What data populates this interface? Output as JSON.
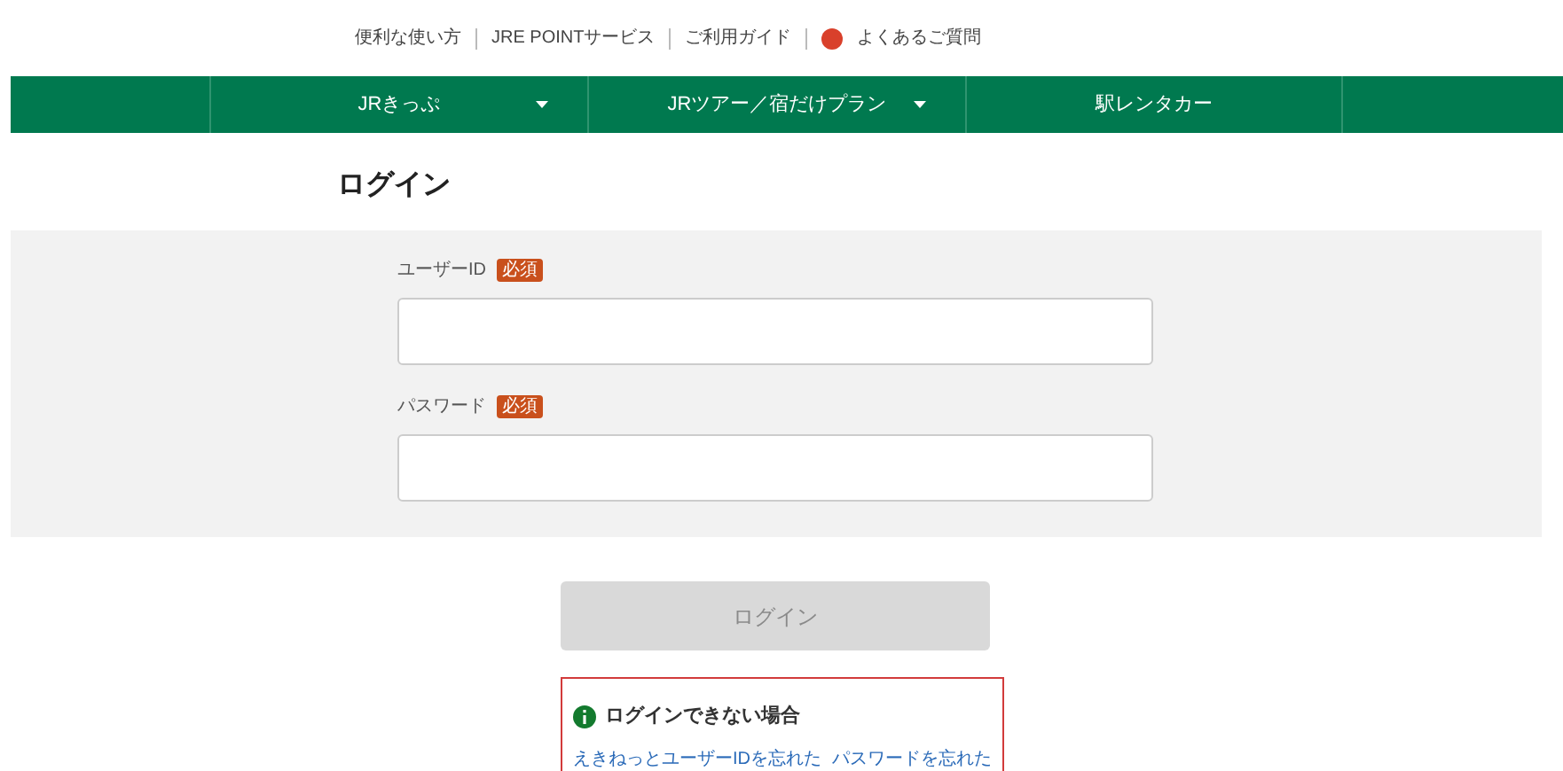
{
  "top_links": [
    {
      "label": "便利な使い方",
      "kind": "plain"
    },
    {
      "label": "JRE POINTサービス",
      "kind": "plain"
    },
    {
      "label": "ご利用ガイド",
      "kind": "plain"
    },
    {
      "label": "よくあるご質問",
      "kind": "help"
    }
  ],
  "nav": [
    {
      "label": "JRきっぷ",
      "dropdown": true
    },
    {
      "label": "JRツアー／宿だけプラン",
      "dropdown": true
    },
    {
      "label": "駅レンタカー",
      "dropdown": false
    }
  ],
  "page_title": "ログイン",
  "fields": [
    {
      "label": "ユーザーID",
      "badge": "必須"
    },
    {
      "label": "パスワード",
      "badge": "必須"
    }
  ],
  "login_button": {
    "label": "ログイン",
    "disabled": true
  },
  "help_box": {
    "title": "ログインできない場合",
    "links": [
      "えきねっとユーザーIDを忘れた",
      "パスワードを忘れた"
    ]
  }
}
